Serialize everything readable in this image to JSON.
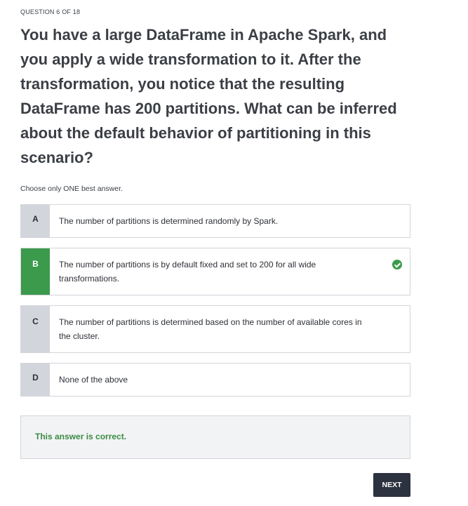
{
  "progress": "QUESTION 6 OF 18",
  "question": "You have a large DataFrame in Apache Spark, and you apply a wide transformation to it. After the transformation, you notice that the resulting DataFrame has 200 partitions. What can be inferred about the default behavior of partitioning in this scenario?",
  "instruction": "Choose only ONE best answer.",
  "options": [
    {
      "letter": "A",
      "text": "The number of partitions is determined randomly by Spark."
    },
    {
      "letter": "B",
      "text": "The number of partitions is by default fixed and set to 200 for all wide transformations.",
      "selected": true,
      "correct": true,
      "status_icon": "check-circle-icon"
    },
    {
      "letter": "C",
      "text": "The number of partitions is determined based on the number of available cores in the cluster."
    },
    {
      "letter": "D",
      "text": "None of the above"
    }
  ],
  "feedback": "This answer is correct.",
  "next_label": "NEXT",
  "colors": {
    "correct": "#3b9a4b",
    "letter_bg": "#d3d5dd",
    "button_bg": "#2d3240",
    "feedback_text": "#3b8a44"
  }
}
